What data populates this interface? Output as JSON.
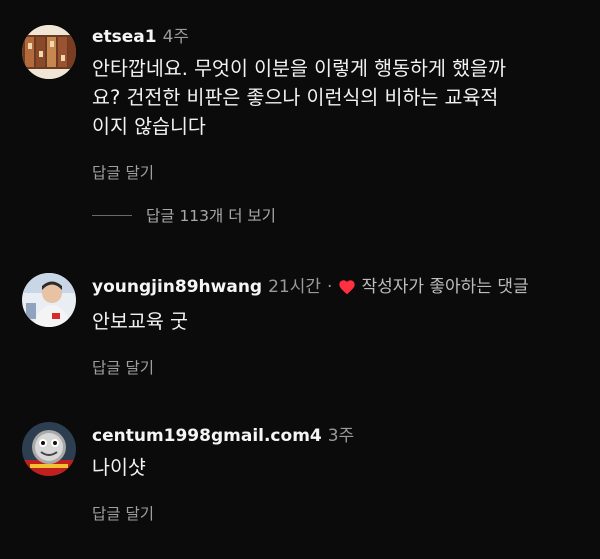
{
  "comments": [
    {
      "username": "etsea1",
      "time": "4주",
      "text": "안타깝네요. 무엇이 이분을 이렇게 행동하게 했을까요? 건전한 비판은 좋으나 이런식의 비하는 교육적이지 않습니다",
      "reply_label": "답글 달기",
      "avatar": "food-photo-avatar"
    },
    {
      "username": "youngjin89hwang",
      "time": "21시간",
      "separator": "·",
      "liked_label": "작성자가 좋아하는 댓글",
      "text": "안보교육 굿",
      "reply_label": "답글 달기",
      "avatar": "person-photo-avatar",
      "heart_color": "#ff3040"
    },
    {
      "username": "centum1998gmail.com4",
      "time": "3주",
      "text": "나이샷",
      "reply_label": "답글 달기",
      "avatar": "cartoon-train-avatar"
    }
  ],
  "view_replies": {
    "label": "답글 113개 더 보기"
  }
}
